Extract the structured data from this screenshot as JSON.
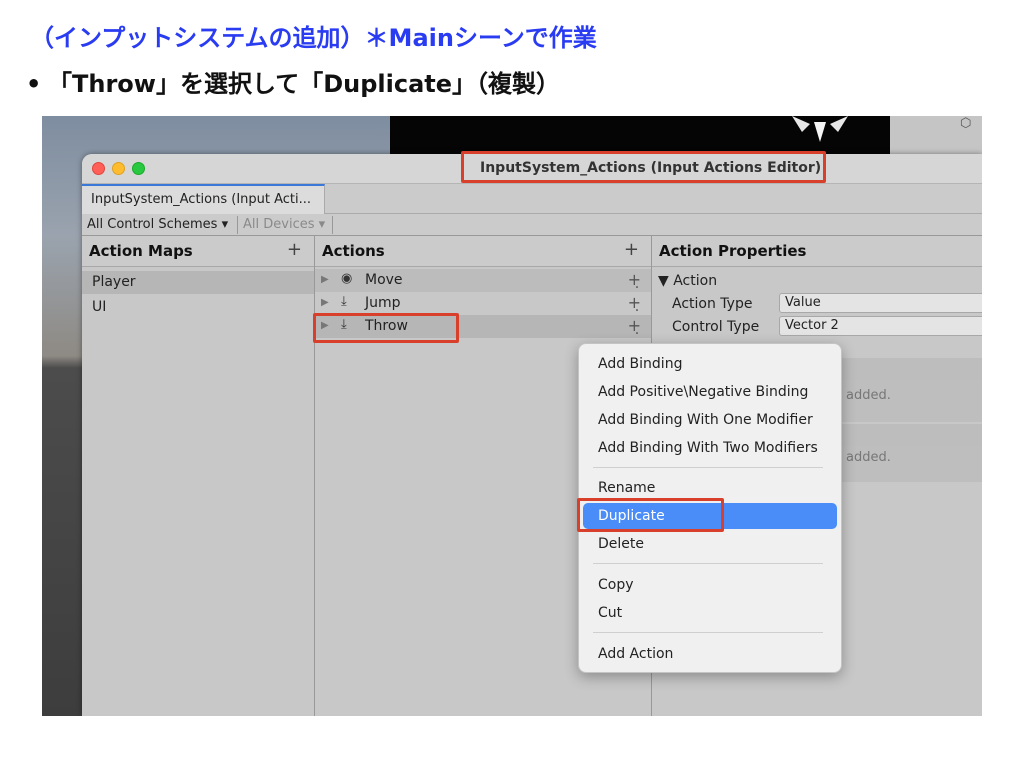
{
  "slide": {
    "heading": "（インプットシステムの追加）＊Mainシーンで作業",
    "bullet_marker": "•",
    "bullet_text": "「Throw」を選択して「Duplicate」（複製）"
  },
  "window": {
    "title": "InputSystem_Actions (Input Actions Editor)",
    "tab_label": "InputSystem_Actions (Input Acti...",
    "control_schemes": "All Control Schemes ▾",
    "devices": "All Devices ▾"
  },
  "action_maps": {
    "header": "Action Maps",
    "add": "+",
    "items": [
      {
        "label": "Player"
      },
      {
        "label": "UI"
      }
    ]
  },
  "actions": {
    "header": "Actions",
    "add": "+",
    "items": [
      {
        "label": "Move",
        "icon": "radio-target-icon"
      },
      {
        "label": "Jump",
        "icon": "download-tray-icon"
      },
      {
        "label": "Throw",
        "icon": "download-tray-icon"
      }
    ]
  },
  "properties": {
    "header": "Action Properties",
    "section": "▼ Action",
    "action_type_label": "Action Type",
    "action_type_value": "Value",
    "control_type_label": "Control Type",
    "control_type_value": "Vector 2",
    "partial_1": "added.",
    "partial_2": "added."
  },
  "context_menu": {
    "items": [
      {
        "label": "Add Binding"
      },
      {
        "label": "Add Positive\\Negative Binding"
      },
      {
        "label": "Add Binding With One Modifier"
      },
      {
        "label": "Add Binding With Two Modifiers"
      },
      {
        "label": "Rename"
      },
      {
        "label": "Duplicate"
      },
      {
        "label": "Delete"
      },
      {
        "label": "Copy"
      },
      {
        "label": "Cut"
      },
      {
        "label": "Add Action"
      }
    ]
  },
  "colors": {
    "heading": "#2a3cf2",
    "highlight": "#d8402c",
    "menu_active": "#4a8df8"
  }
}
